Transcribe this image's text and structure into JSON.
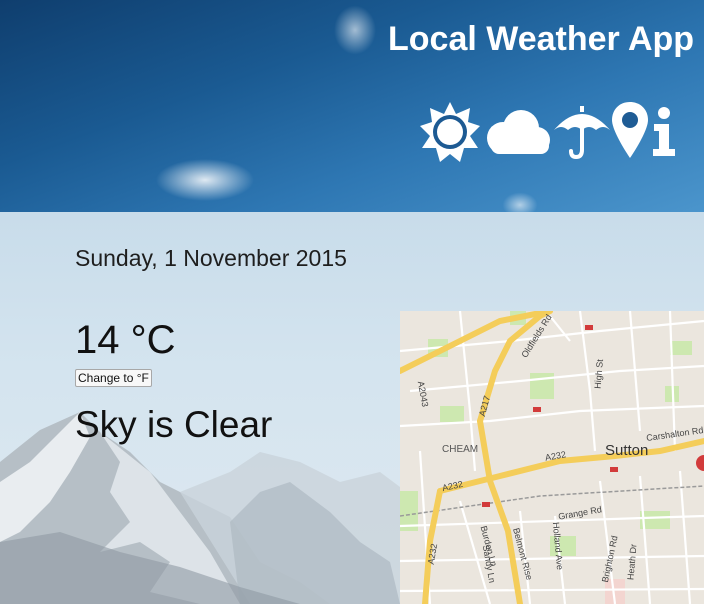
{
  "header": {
    "title": "Local Weather App",
    "icons": [
      "sun-icon",
      "cloud-icon",
      "umbrella-icon",
      "map-pin-icon",
      "info-icon"
    ]
  },
  "weather": {
    "date": "Sunday, 1 November 2015",
    "temperature": "14 °C",
    "unit_button_label": "Change to °F",
    "description": "Sky is Clear"
  },
  "map": {
    "labels": {
      "oldfields_rd": "Oldfields Rd",
      "a2043": "A2043",
      "a217": "A217",
      "high_st": "High St",
      "cheam": "CHEAM",
      "sutton": "Sutton",
      "carshalton_rd": "Carshalton Rd",
      "a232_center": "A232",
      "a232_left": "A232",
      "a232_bottom": "A232",
      "grange_rd": "Grange Rd",
      "burdon_ln": "Burdon Ln",
      "sandy_ln": "Sandy Ln",
      "belmont_rise": "Belmont Rise",
      "holland_ave": "Holland Ave",
      "brighton_rd": "Brighton Rd",
      "heath_dr": "Heath Dr"
    }
  },
  "colors": {
    "sky_dark": "#0f3e6e",
    "sky_light": "#4b95cc",
    "major_road": "#f4cd5a",
    "park": "#cde8b0"
  }
}
